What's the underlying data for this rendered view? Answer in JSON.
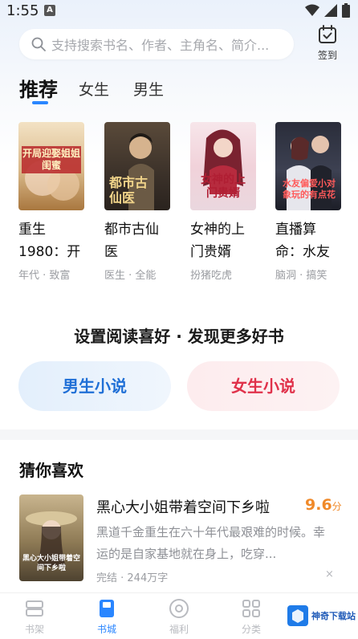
{
  "status_bar": {
    "time": "1:55",
    "notification_letter": "A"
  },
  "search": {
    "placeholder": "支持搜索书名、作者、主角名、简介..."
  },
  "signin": {
    "label": "签到"
  },
  "tabs": [
    {
      "label": "推荐",
      "active": true
    },
    {
      "label": "女生",
      "active": false
    },
    {
      "label": "男生",
      "active": false
    }
  ],
  "books": [
    {
      "title": "重生1980：开",
      "tags": "年代 · 致富",
      "cover_text": "开局迎娶姐姐闺蜜",
      "cover_icon": "romance-cover"
    },
    {
      "title": "都市古仙医",
      "tags": "医生 · 全能",
      "cover_text": "都市古仙医",
      "cover_icon": "man-portrait-cover"
    },
    {
      "title": "女神的上门贵婿",
      "tags": "扮猪吃虎",
      "cover_text": "女神的上门贵婿",
      "cover_icon": "woman-portrait-cover"
    },
    {
      "title": "直播算命：水友",
      "tags": "脑洞 · 搞笑",
      "cover_text": "水友偏爱小对象玩的有点花",
      "cover_icon": "couple-cover"
    }
  ],
  "preference": {
    "title": "设置阅读喜好 · 发现更多好书",
    "male_label": "男生小说",
    "female_label": "女生小说"
  },
  "recommendation": {
    "heading": "猜你喜欢",
    "title": "黑心大小姐带着空间下乡啦",
    "score": "9.6",
    "score_unit": "分",
    "description": "黑道千金重生在六十年代最艰难的时候。幸运的是自家基地就在身上，吃穿...",
    "meta": "完结 · 244万字",
    "close": "×",
    "cover_text": "黑心大小姐带着空间下乡啦"
  },
  "bottom_nav": [
    {
      "label": "书架",
      "icon": "bookshelf-icon",
      "active": false
    },
    {
      "label": "书城",
      "icon": "book-store-icon",
      "active": true
    },
    {
      "label": "福利",
      "icon": "welfare-icon",
      "active": false
    },
    {
      "label": "分类",
      "icon": "category-grid-icon",
      "active": false
    }
  ],
  "watermark": {
    "text": "神奇下载站"
  },
  "colors": {
    "accent": "#2a86ff",
    "male": "#1f6fd6",
    "female": "#e0314a",
    "score": "#f08a2a"
  }
}
